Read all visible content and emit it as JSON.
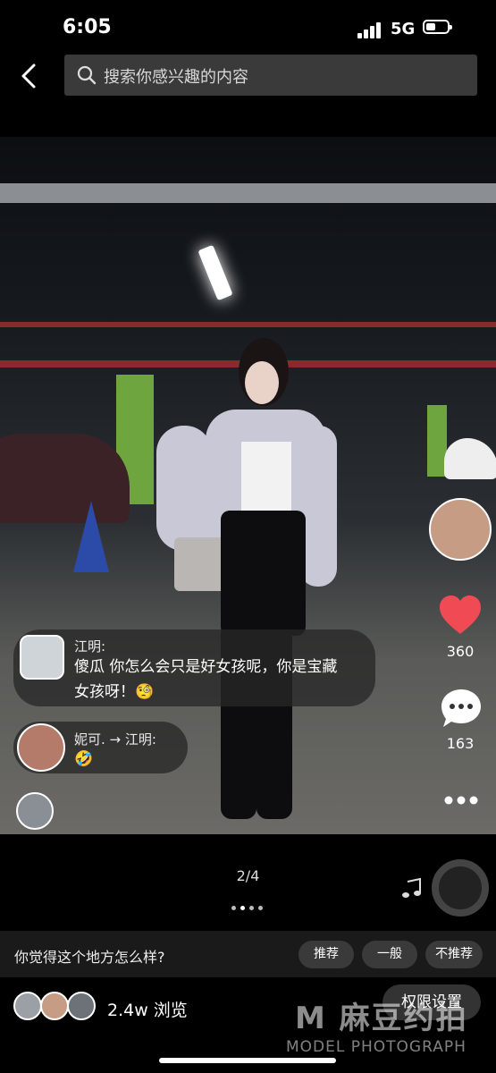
{
  "status": {
    "time": "6:05",
    "network": "5G"
  },
  "header": {
    "search_placeholder": "搜索你感兴趣的内容"
  },
  "comments": [
    {
      "user": "江明:",
      "text_line1": "傻瓜 你怎么会只是好女孩呢，你是宝藏",
      "text_line2": "女孩呀！🧐"
    },
    {
      "user": "妮可. → 江明:",
      "text": "🤣"
    }
  ],
  "right_actions": {
    "likes": "360",
    "comments": "163"
  },
  "gallery": {
    "page_indicator": "2/4"
  },
  "feedback": {
    "question": "你觉得这个地方怎么样?",
    "options": [
      "推荐",
      "一般",
      "不推荐"
    ]
  },
  "footer": {
    "views": "2.4w 浏览",
    "permission_button": "权限设置",
    "watermark_cn": "M 麻豆约拍",
    "watermark_en": "MODEL PHOTOGRAPH"
  },
  "colors": {
    "like_red": "#f04b55",
    "pillar_green": "#6fa53f"
  }
}
